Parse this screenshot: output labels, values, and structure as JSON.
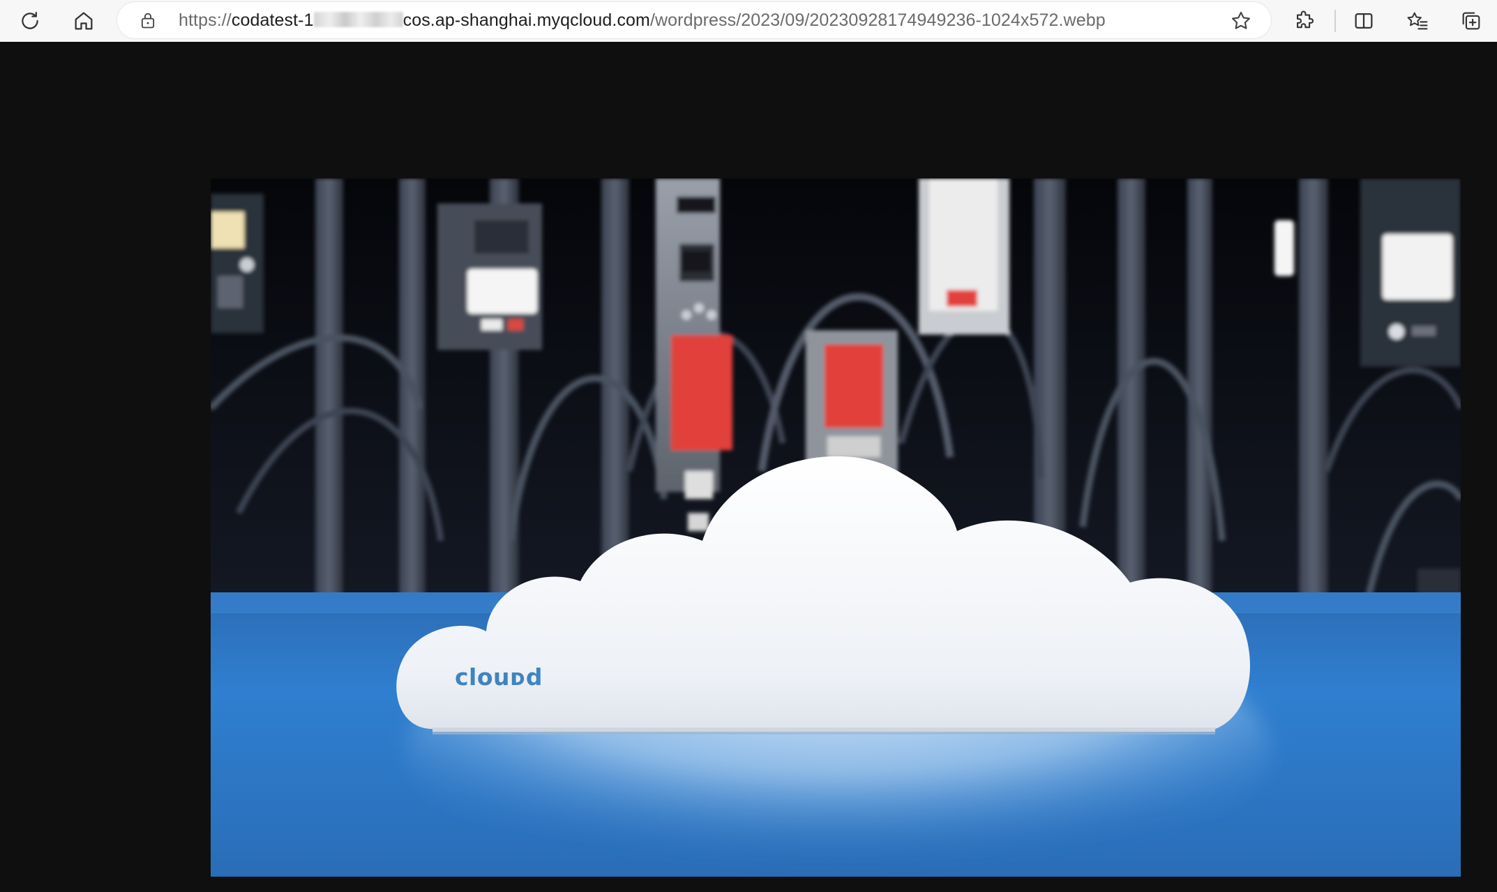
{
  "browser": {
    "url_prefix": "https://",
    "url_host_start": "codatest-1",
    "url_host_end": "cos.ap-shanghai.myqcloud.com",
    "url_path": "/wordpress/2023/09/20230928174949236-1024x572.webp"
  },
  "toolbar_icons": {
    "refresh": "refresh-icon",
    "home": "home-icon",
    "lock": "lock-icon",
    "favorite": "star-icon",
    "extensions": "puzzle-icon",
    "split_screen": "split-screen-icon",
    "favorites": "favorites-list-icon",
    "collections": "collections-icon"
  },
  "image": {
    "cloud_label": "clouᴅd",
    "colors": {
      "background": "#0f0f0f",
      "table_blue": "#2f7fd0",
      "cloud_white": "#f4f6fa",
      "rack_red": "#e2403a",
      "label_blue": "#3f84c2"
    }
  }
}
